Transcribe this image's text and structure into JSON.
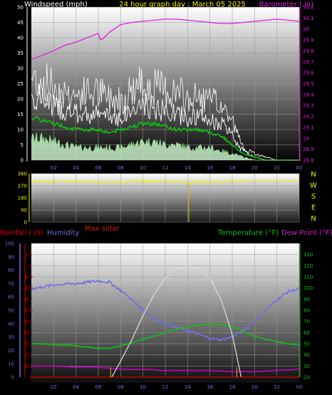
{
  "header": {
    "windspeed_label": "Windspeed (mph)",
    "title": "24 hour graph day : March 05 2025",
    "barometer_label": "Barometer (.in)"
  },
  "mid": {
    "max_solar_label": "Max solar"
  },
  "bottom": {
    "rainfall_label": "Rainfall (.in)",
    "humidity_label": "Humidity",
    "temperature_label": "Temperature (°F)",
    "dewpoint_label": "Dew Point (°F)"
  },
  "colors": {
    "windspeed": "#ffffff",
    "gust": "#ffffff",
    "wind_avg": "#10c010",
    "wind_fill": "#c8f0c8",
    "barometer": "#e020e0",
    "direction": "#f0f000",
    "rainfall": "#e00000",
    "humidity": "#7070e0",
    "temperature": "#10c010",
    "dewpoint": "#c000c0",
    "solar": "#d8d8d8",
    "max_solar": "#d02020",
    "marker": "#e0c000"
  },
  "chart_data": [
    {
      "type": "line",
      "title": "24 hour graph day : March 05 2025",
      "x_ticks": [
        "02",
        "04",
        "06",
        "08",
        "10",
        "12",
        "14",
        "16",
        "18",
        "20",
        "22",
        "00"
      ],
      "x_hours": [
        2,
        4,
        6,
        8,
        10,
        12,
        14,
        16,
        18,
        20,
        22,
        24
      ],
      "ylabel_left": "Windspeed (mph)",
      "ylim_left": [
        0,
        50
      ],
      "yticks_left": [
        "0",
        "5",
        "10",
        "15",
        "20",
        "25",
        "30",
        "35",
        "40",
        "45",
        "50"
      ],
      "ylabel_right": "Barometer (.in)",
      "ylim_right": [
        28.8,
        30.2
      ],
      "yticks_right": [
        "28.8",
        "28.9",
        "29",
        "29.1",
        "29.2",
        "29.3",
        "29.4",
        "29.5",
        "29.6",
        "29.7",
        "29.8",
        "29.9",
        "30",
        "30.1",
        "30.2"
      ],
      "series": [
        {
          "name": "Barometer (.in)",
          "axis": "right",
          "x": [
            0,
            1,
            2,
            3,
            4,
            5,
            6,
            6.2,
            6.4,
            7,
            8,
            9,
            10,
            11,
            12,
            13,
            14,
            15,
            16,
            17,
            18,
            19,
            20,
            21,
            22,
            23,
            24
          ],
          "values": [
            29.72,
            29.76,
            29.8,
            29.85,
            29.88,
            29.92,
            29.96,
            29.9,
            29.91,
            29.97,
            30.04,
            30.06,
            30.07,
            30.08,
            30.09,
            30.09,
            30.08,
            30.07,
            30.06,
            30.05,
            30.05,
            30.06,
            30.07,
            30.08,
            30.09,
            30.08,
            30.07
          ]
        },
        {
          "name": "Wind gust",
          "axis": "left",
          "x": [
            0,
            1,
            2,
            3,
            4,
            5,
            6,
            7,
            8,
            9,
            10,
            11,
            12,
            13,
            14,
            15,
            16,
            17,
            18,
            18.5,
            19,
            20,
            21,
            22,
            23,
            24
          ],
          "values": [
            27,
            26,
            24,
            22,
            21,
            22,
            22,
            20,
            20,
            23,
            25,
            24,
            23,
            22,
            20,
            20,
            19,
            18,
            13,
            8,
            4,
            2,
            1,
            0,
            0,
            0
          ]
        },
        {
          "name": "Windspeed",
          "axis": "left",
          "x": [
            0,
            1,
            2,
            3,
            4,
            5,
            6,
            7,
            8,
            9,
            10,
            11,
            12,
            13,
            14,
            15,
            16,
            17,
            18,
            18.5,
            19,
            20,
            21,
            22,
            23,
            24
          ],
          "values": [
            21,
            20,
            18,
            16,
            15,
            15,
            15,
            14,
            14,
            16,
            18,
            17,
            16,
            15,
            14,
            14,
            13,
            12,
            8,
            5,
            3,
            1,
            0,
            0,
            0,
            0
          ]
        },
        {
          "name": "Wind average",
          "axis": "left",
          "x": [
            0,
            1,
            2,
            3,
            4,
            5,
            6,
            7,
            8,
            9,
            10,
            11,
            12,
            13,
            14,
            15,
            16,
            17,
            18,
            19,
            20,
            21,
            22,
            23,
            24
          ],
          "values": [
            14,
            13,
            12,
            11,
            10,
            10,
            10,
            9,
            10,
            11,
            12,
            12,
            11,
            10,
            10,
            10,
            9,
            8,
            5,
            2,
            1,
            0,
            0,
            0,
            0
          ]
        },
        {
          "name": "Wind lull",
          "axis": "left",
          "x": [
            0,
            1,
            2,
            3,
            4,
            5,
            6,
            7,
            8,
            9,
            10,
            11,
            12,
            13,
            14,
            15,
            16,
            17,
            18,
            19,
            20,
            21,
            22,
            23,
            24
          ],
          "values": [
            7,
            7,
            6,
            5,
            4,
            4,
            4,
            4,
            4,
            5,
            6,
            6,
            5,
            5,
            4,
            4,
            4,
            3,
            2,
            1,
            0,
            0,
            0,
            0,
            0
          ]
        }
      ]
    },
    {
      "type": "line",
      "ylim": [
        0,
        360
      ],
      "yticks": [
        "0",
        "90",
        "180",
        "270",
        "360"
      ],
      "direction_labels": [
        "N",
        "W",
        "S",
        "E",
        "N"
      ],
      "series": [
        {
          "name": "Wind direction",
          "x": [
            0,
            2,
            4,
            6,
            8,
            10,
            12,
            14,
            16,
            18,
            19,
            20,
            22,
            24
          ],
          "values": [
            302,
            300,
            304,
            298,
            300,
            306,
            302,
            296,
            300,
            304,
            306,
            306,
            306,
            306
          ]
        }
      ],
      "markers_hours": [
        14.1
      ]
    },
    {
      "type": "line",
      "legend": [
        "Rainfall (.in)",
        "Humidity",
        "Max solar",
        "Temperature (°F)",
        "Dew Point (°F)"
      ],
      "ylim_humidity": [
        0,
        100
      ],
      "yticks_humidity": [
        "0",
        "10",
        "20",
        "30",
        "40",
        "50",
        "60",
        "70",
        "80",
        "90",
        "100"
      ],
      "ylim_rain": [
        0,
        1.2
      ],
      "yticks_rain": [
        "0",
        "0.1",
        "0.2",
        "0.3",
        "0.4",
        "0.5",
        "0.6",
        "0.7",
        "0.8",
        "0.9",
        "1",
        "1.1"
      ],
      "ylim_temp": [
        20,
        140
      ],
      "yticks_temp": [
        "20",
        "30",
        "40",
        "50",
        "60",
        "70",
        "80",
        "90",
        "100",
        "110",
        "120",
        "130"
      ],
      "series": [
        {
          "name": "Humidity",
          "axis": "humidity",
          "x": [
            0,
            2,
            4,
            6,
            7,
            8,
            9,
            10,
            11,
            12,
            13,
            14,
            15,
            16,
            17,
            18,
            19,
            20,
            21,
            22,
            23,
            24
          ],
          "values": [
            66,
            69,
            70,
            72,
            71,
            65,
            58,
            50,
            44,
            40,
            37,
            35,
            32,
            29,
            28,
            30,
            35,
            42,
            50,
            58,
            64,
            66
          ]
        },
        {
          "name": "Temperature (°F)",
          "axis": "temp",
          "x": [
            0,
            1,
            2,
            3,
            4,
            5,
            6,
            7,
            8,
            9,
            10,
            11,
            12,
            13,
            14,
            15,
            16,
            17,
            18,
            19,
            20,
            21,
            22,
            23,
            24
          ],
          "values": [
            50,
            50,
            49,
            49,
            48,
            47,
            46,
            46,
            48,
            51,
            54,
            57,
            60,
            63,
            65,
            67,
            68,
            67,
            65,
            61,
            57,
            54,
            52,
            50,
            49
          ]
        },
        {
          "name": "Dew Point (°F)",
          "axis": "temp",
          "x": [
            0,
            2,
            4,
            6,
            8,
            10,
            12,
            14,
            16,
            18,
            20,
            22,
            24
          ],
          "values": [
            30,
            30,
            29,
            29,
            27,
            27,
            26,
            26,
            26,
            25,
            25,
            26,
            27
          ]
        },
        {
          "name": "Max solar",
          "axis": "humidity",
          "x": [
            7.2,
            8,
            9,
            10,
            11,
            12,
            13,
            14,
            15,
            16,
            17,
            18,
            18.8
          ],
          "values": [
            0,
            12,
            28,
            46,
            62,
            74,
            81,
            83,
            81,
            74,
            58,
            32,
            0
          ]
        },
        {
          "name": "Rainfall (.in)",
          "axis": "rain",
          "x": [
            0,
            24
          ],
          "values": [
            0,
            0
          ]
        }
      ],
      "markers_hours": [
        7.1,
        18.4
      ]
    }
  ]
}
